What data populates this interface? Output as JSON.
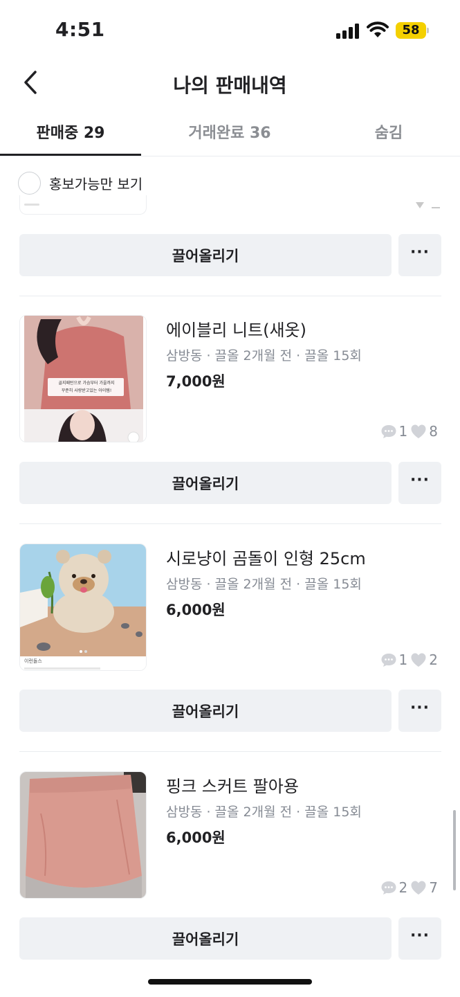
{
  "status_bar": {
    "time": "4:51",
    "battery": "58"
  },
  "header": {
    "title": "나의 판매내역"
  },
  "tabs": [
    {
      "label": "판매중 29"
    },
    {
      "label": "거래완료 36"
    },
    {
      "label": "숨김"
    }
  ],
  "filter": {
    "label": "홍보가능만 보기"
  },
  "actions": {
    "bump_label": "끌어올리기",
    "more_label": "···"
  },
  "products": [
    {
      "title": "에이블리 니트(새옷)",
      "meta": "삼방동 · 끌올 2개월 전 · 끌올 15회",
      "price": "7,000원",
      "chats": "1",
      "likes": "8",
      "image_caption1": "골지패턴으로 가슴부터 가을까지",
      "image_caption2": "꾸준히 사랑받고있는 아이템!"
    },
    {
      "title": "시로냥이 곰돌이 인형 25cm",
      "meta": "삼방동 · 끌올 2개월 전 · 끌올 15회",
      "price": "6,000원",
      "chats": "1",
      "likes": "2",
      "image_caption1": "이런돌스"
    },
    {
      "title": "핑크 스커트 팔아용",
      "meta": "삼방동 · 끌올 2개월 전 · 끌올 15회",
      "price": "6,000원",
      "chats": "2",
      "likes": "7"
    }
  ],
  "colors": {
    "accent": "#212124",
    "muted": "#868b94",
    "button_bg": "#eff1f4",
    "battery": "#f4d000"
  }
}
